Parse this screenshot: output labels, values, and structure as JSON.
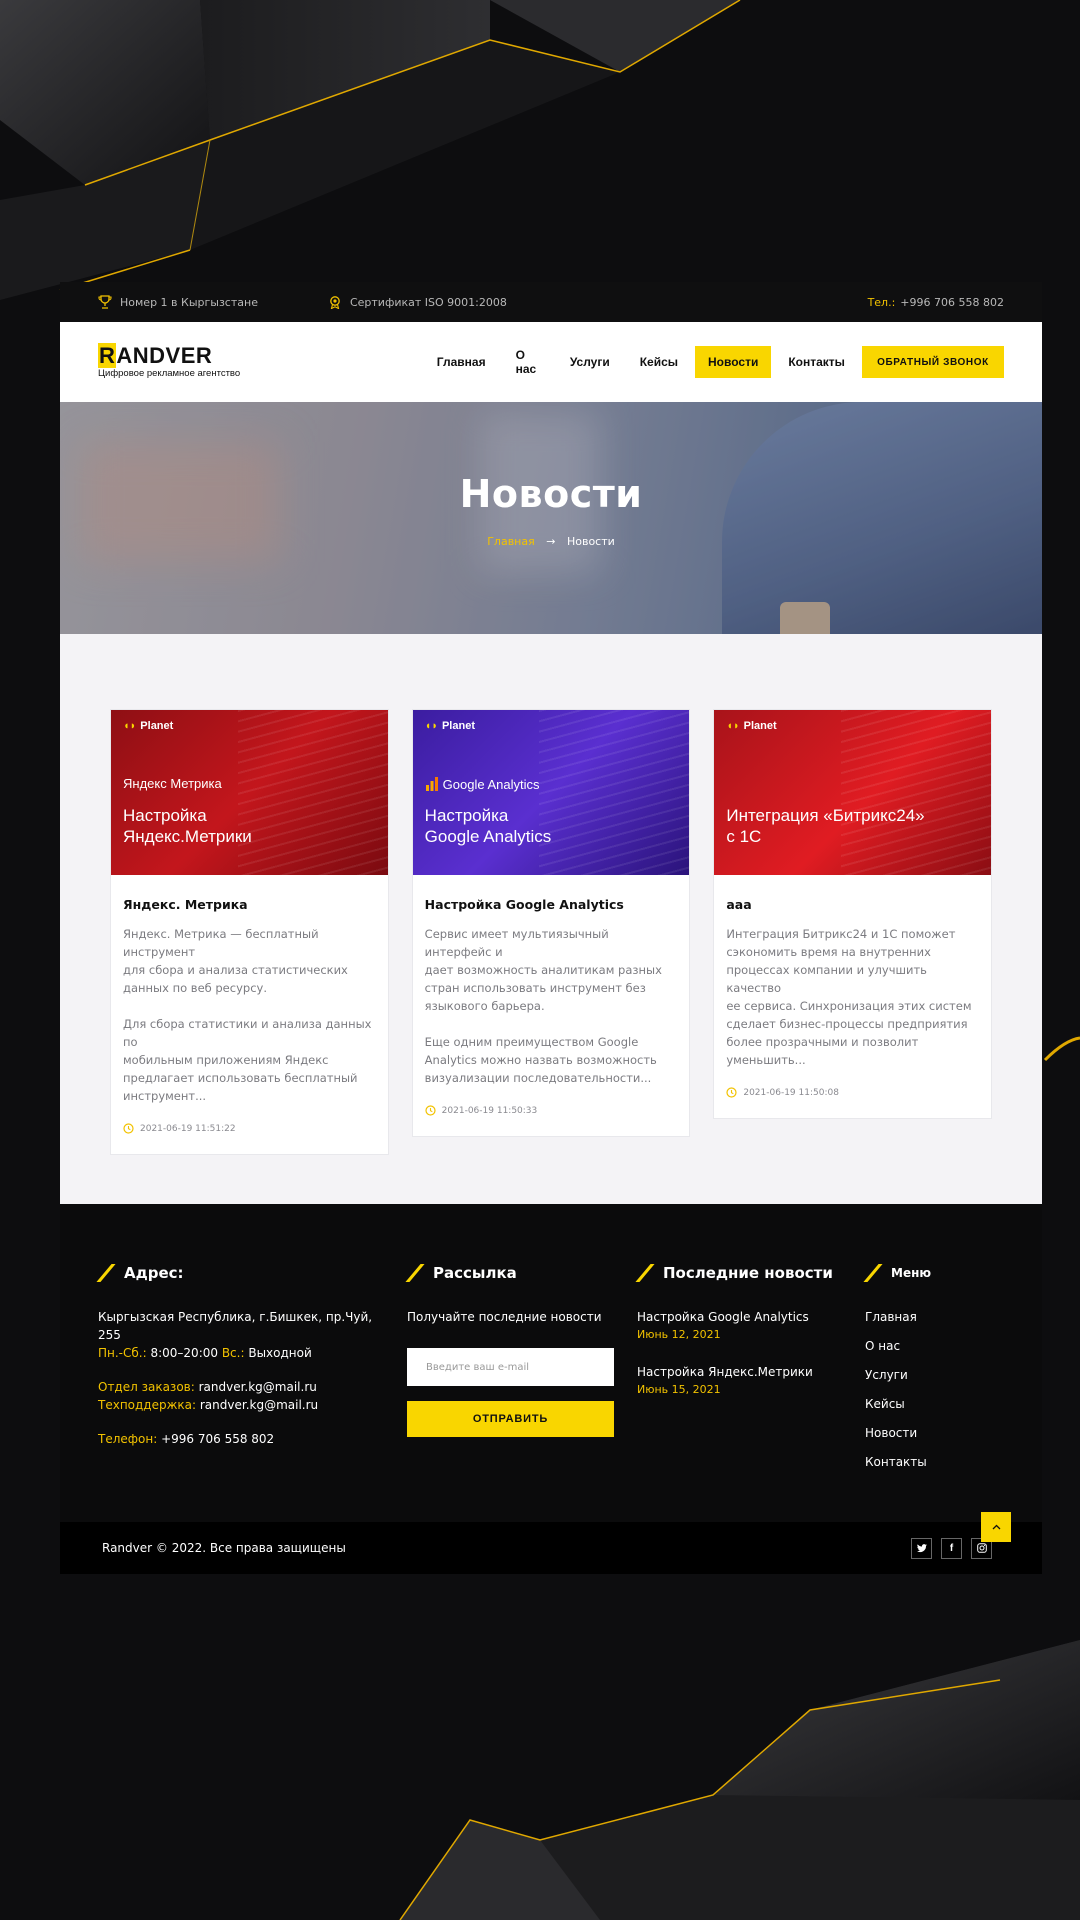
{
  "topbar": {
    "award": "Номер 1 в Кыргызстане",
    "certificate": "Сертификат ISO 9001:2008",
    "phone_label": "Тел.:",
    "phone": "+996 706 558 802"
  },
  "header": {
    "logo_first": "R",
    "logo_rest": "ANDVER",
    "logo_tagline": "Цифровое рекламное агентство",
    "nav": [
      "Главная",
      "О нас",
      "Услуги",
      "Кейсы",
      "Новости",
      "Контакты"
    ],
    "active_nav": "Новости",
    "callback_button": "ОБРАТНЫЙ ЗВОНОК"
  },
  "hero": {
    "title": "Новости",
    "breadcrumb_home": "Главная",
    "breadcrumb_arrow": "→",
    "breadcrumb_current": "Новости"
  },
  "news": [
    {
      "image_brand": "Planet",
      "image_sub": "Яндекс Метрика",
      "image_caption": "Настройка\nЯндекс.Метрики",
      "title": "Яндекс. Метрика",
      "text": "Яндекс. Метрика — бесплатный инструмент\nдля сбора и анализа статистических\nданных по веб ресурсу.\n\nДля сбора статистики и анализа данных по\nмобильным приложениям Яндекс\nпредлагает использовать бесплатный\nинструмент...",
      "date": "2021-06-19 11:51:22"
    },
    {
      "image_brand": "Planet",
      "image_sub": "Google Analytics",
      "image_caption": "Настройка\nGoogle Analytics",
      "title": "Настройка Google Analytics",
      "text": "Сервис имеет мультиязычный интерфейс и\nдает возможность аналитикам разных\nстран использовать инструмент без\nязыкового барьера.\n\nЕще одним преимуществом Google\nAnalytics можно назвать возможность\nвизуализации последовательности...",
      "date": "2021-06-19 11:50:33"
    },
    {
      "image_brand": "Planet",
      "image_sub": "",
      "image_caption": "Интеграция «Битрикс24»\nс 1С",
      "title": "aaa",
      "text": "Интеграция Битрикс24 и 1С поможет\nсэкономить время на внутренних\nпроцессах компании и улучшить качество\nее сервиса. Синхронизация этих систем\nсделает бизнес-процессы предприятия\nболее прозрачными и позволит\nуменьшить...",
      "date": "2021-06-19 11:50:08"
    }
  ],
  "footer": {
    "address": {
      "heading": "Адрес:",
      "line1": "Кыргызская Республика, г.Бишкек, пр.Чуй, 255",
      "hours_k1": "Пн.-Сб.:",
      "hours_v1": " 8:00–20:00 ",
      "hours_k2": "Вс.:",
      "hours_v2": " Выходной",
      "orders_k": "Отдел заказов:",
      "orders_v": " randver.kg@mail.ru",
      "support_k": "Техподдержка:",
      "support_v": " randver.kg@mail.ru",
      "phone_k": "Телефон:",
      "phone_v": " +996 706 558 802"
    },
    "newsletter": {
      "heading": "Рассылка",
      "text": "Получайте последние новости",
      "placeholder": "Введите ваш e-mail",
      "button": "ОТПРАВИТЬ"
    },
    "latest": {
      "heading": "Последние новости",
      "items": [
        {
          "title": "Настройка Google Analytics",
          "date": "Июнь 12, 2021"
        },
        {
          "title": "Настройка Яндекс.Метрики",
          "date": "Июнь 15, 2021"
        }
      ]
    },
    "menu": {
      "heading": "Меню",
      "items": [
        "Главная",
        "О нас",
        "Услуги",
        "Кейсы",
        "Новости",
        "Контакты"
      ]
    },
    "copyright": "Randver © 2022. Все права защищены",
    "socials": [
      "twitter",
      "facebook",
      "instagram"
    ],
    "to_top": "^"
  },
  "colors": {
    "accent": "#f9d600",
    "dark": "#0b0b0c",
    "light_section": "#f4f3f6"
  }
}
